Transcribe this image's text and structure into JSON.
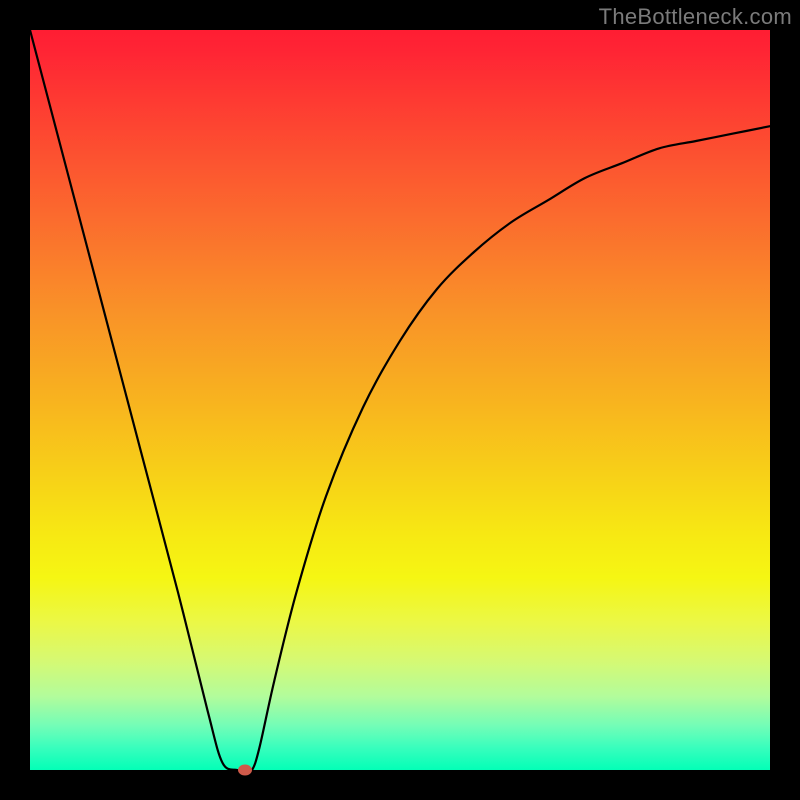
{
  "watermark": "TheBottleneck.com",
  "chart_data": {
    "type": "line",
    "title": "",
    "xlabel": "",
    "ylabel": "",
    "xlim": [
      0,
      100
    ],
    "ylim": [
      0,
      100
    ],
    "grid": false,
    "legend": false,
    "background_gradient": {
      "top": "#ff1d33",
      "mid": "#f7e813",
      "bottom": "#03ffb7"
    },
    "series": [
      {
        "name": "bottleneck-curve",
        "color": "#000000",
        "x": [
          0,
          5,
          10,
          15,
          20,
          24,
          26,
          28,
          29,
          30,
          31,
          33,
          36,
          40,
          45,
          50,
          55,
          60,
          65,
          70,
          75,
          80,
          85,
          90,
          95,
          100
        ],
        "y": [
          100,
          81,
          62,
          43,
          24,
          8,
          1,
          0,
          0,
          0,
          3,
          12,
          24,
          37,
          49,
          58,
          65,
          70,
          74,
          77,
          80,
          82,
          84,
          85,
          86,
          87
        ]
      }
    ],
    "marker": {
      "x": 29,
      "y": 0,
      "color": "#cf5a4a"
    }
  }
}
